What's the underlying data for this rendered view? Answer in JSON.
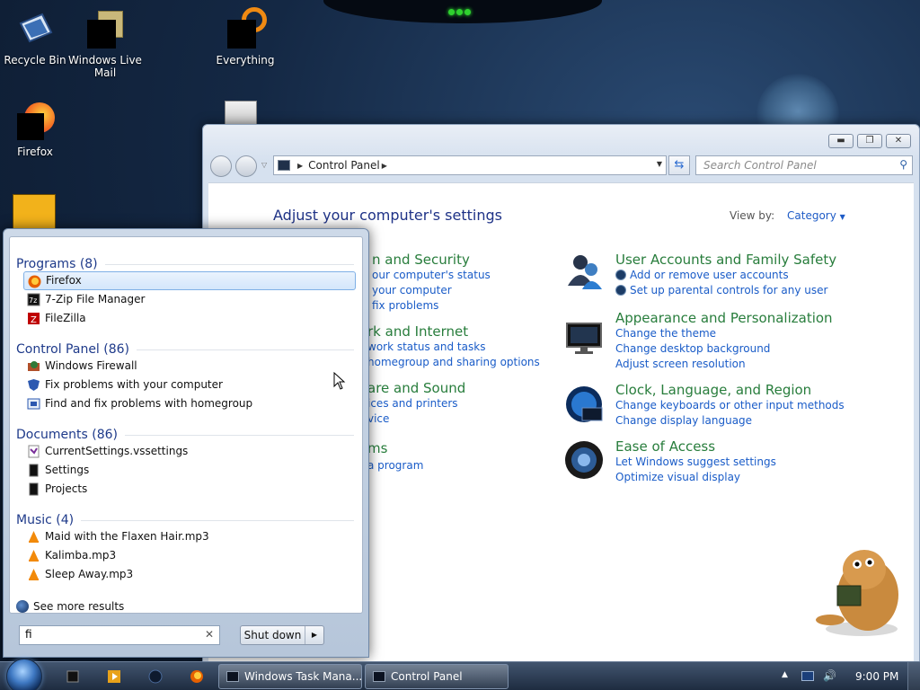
{
  "desktop": {
    "icons": [
      {
        "label": "Recycle Bin"
      },
      {
        "label": "Windows Live Mail"
      },
      {
        "label": "Everything"
      },
      {
        "label": "Firefox"
      }
    ]
  },
  "control_panel": {
    "address": "Control Panel",
    "search_placeholder": "Search Control Panel",
    "heading": "Adjust your computer's settings",
    "view_by_label": "View by:",
    "view_by_value": "Category",
    "left_categories": [
      {
        "title": "n and Security",
        "links": [
          "our computer's status",
          "your computer",
          "fix problems"
        ]
      },
      {
        "title": "rk and Internet",
        "links": [
          "work status and tasks",
          "homegroup and sharing options"
        ]
      },
      {
        "title": "are and Sound",
        "links": [
          "ices and printers",
          "vice"
        ]
      },
      {
        "title": "ms",
        "links": [
          "a program"
        ]
      }
    ],
    "right_categories": [
      {
        "title": "User Accounts and Family Safety",
        "links": [
          "Add or remove user accounts",
          "Set up parental controls for any user"
        ]
      },
      {
        "title": "Appearance and Personalization",
        "links": [
          "Change the theme",
          "Change desktop background",
          "Adjust screen resolution"
        ]
      },
      {
        "title": "Clock, Language, and Region",
        "links": [
          "Change keyboards or other input methods",
          "Change display language"
        ]
      },
      {
        "title": "Ease of Access",
        "links": [
          "Let Windows suggest settings",
          "Optimize visual display"
        ]
      }
    ]
  },
  "start_menu": {
    "sections": [
      {
        "header": "Programs (8)",
        "items": [
          "Firefox",
          "7-Zip File Manager",
          "FileZilla"
        ]
      },
      {
        "header": "Control Panel (86)",
        "items": [
          "Windows Firewall",
          "Fix problems with your computer",
          "Find and fix problems with homegroup"
        ]
      },
      {
        "header": "Documents (86)",
        "items": [
          "CurrentSettings.vssettings",
          "Settings",
          "Projects"
        ]
      },
      {
        "header": "Music (4)",
        "items": [
          "Maid with the Flaxen Hair.mp3",
          "Kalimba.mp3",
          "Sleep Away.mp3"
        ]
      }
    ],
    "see_more": "See more results",
    "search_value": "fi",
    "shutdown_label": "Shut down"
  },
  "taskbar": {
    "tasks": [
      "Windows Task Mana...",
      "Control Panel"
    ],
    "clock": "9:00 PM"
  }
}
